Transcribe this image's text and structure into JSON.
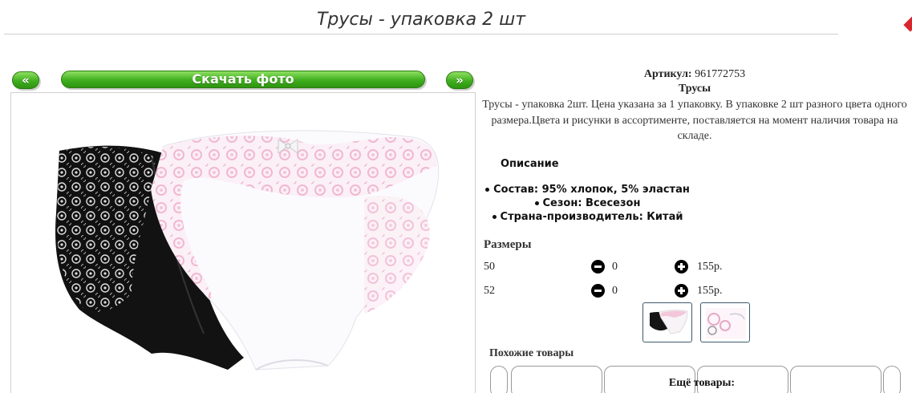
{
  "page": {
    "title": "Трусы - упаковка 2 шт"
  },
  "gallery": {
    "prev_label": "«",
    "next_label": "»",
    "download_label": "Скачать фото"
  },
  "product": {
    "article_label": "Артикул:",
    "article_value": "961772753",
    "category": "Трусы",
    "description": "Трусы - упаковка 2шт. Цена указана за 1 упаковку. В упаковке 2 шт разного цвета одного размера.Цвета и рисунки в ассортименте, поставляется на момент наличия товара на складе.",
    "desc_header": "Описание",
    "properties": [
      "Состав: 95% хлопок, 5% эластан",
      "Сезон: Всесезон",
      "Страна-производитель: Китай"
    ]
  },
  "sizes": {
    "header": "Размеры",
    "rows": [
      {
        "size": "50",
        "qty": "0",
        "price": "155р."
      },
      {
        "size": "52",
        "qty": "0",
        "price": "155р."
      }
    ]
  },
  "similar": {
    "header": "Похожие товары",
    "more_label": "Ещё товары:"
  },
  "icons": {
    "minus": "minus-circle-icon",
    "plus": "plus-circle-icon"
  }
}
